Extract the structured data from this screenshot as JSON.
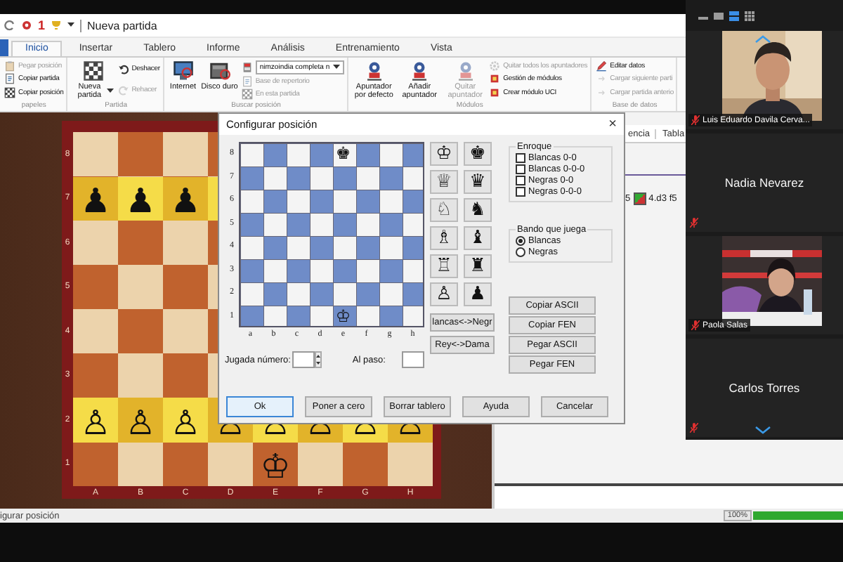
{
  "window": {
    "title": "Nueva partida",
    "quick_badge": "1"
  },
  "ribbon_tabs": [
    {
      "label": "Inicio",
      "selected": true
    },
    {
      "label": "Insertar",
      "selected": false
    },
    {
      "label": "Tablero",
      "selected": false
    },
    {
      "label": "Informe",
      "selected": false
    },
    {
      "label": "Análisis",
      "selected": false
    },
    {
      "label": "Entrenamiento",
      "selected": false
    },
    {
      "label": "Vista",
      "selected": false
    }
  ],
  "ribbon_groups": [
    {
      "label": "papeles",
      "items": [
        {
          "kind": "small",
          "label": "Pegar posición",
          "disabled": true
        },
        {
          "kind": "small",
          "label": "Copiar partida",
          "disabled": false
        },
        {
          "kind": "small",
          "label": "Copiar posición",
          "disabled": false
        }
      ]
    },
    {
      "label": "Partida",
      "items": [
        {
          "kind": "large-menu",
          "label": "Nueva partida",
          "disabled": false
        },
        {
          "kind": "small",
          "label": "Deshacer",
          "disabled": false
        },
        {
          "kind": "small",
          "label": "Rehacer",
          "disabled": true
        }
      ]
    },
    {
      "label": "Buscar posición",
      "items": [
        {
          "kind": "large",
          "label": "Internet",
          "disabled": false
        },
        {
          "kind": "large",
          "label": "Disco duro",
          "disabled": false
        },
        {
          "kind": "dropdown",
          "label": "nimzoindia completa n",
          "disabled": false
        },
        {
          "kind": "small",
          "label": "Base de repertorio",
          "disabled": true
        },
        {
          "kind": "small",
          "label": "En esta partida",
          "disabled": true
        }
      ]
    },
    {
      "label": "Módulos",
      "items": [
        {
          "kind": "large",
          "label": "Apuntador por defecto",
          "disabled": false
        },
        {
          "kind": "large",
          "label": "Añadir apuntador",
          "disabled": false
        },
        {
          "kind": "large",
          "label": "Quitar apuntador",
          "disabled": true
        },
        {
          "kind": "small",
          "label": "Quitar todos los apuntadores",
          "disabled": true
        },
        {
          "kind": "small",
          "label": "Gestión de módulos",
          "disabled": false
        },
        {
          "kind": "small",
          "label": "Crear módulo UCI",
          "disabled": false
        }
      ]
    },
    {
      "label": "Base de datos",
      "items": [
        {
          "kind": "small",
          "label": "Editar datos",
          "disabled": false
        },
        {
          "kind": "small",
          "label": "Cargar siguiente parti",
          "disabled": true
        },
        {
          "kind": "small",
          "label": "Cargar partida anterio",
          "disabled": true
        }
      ]
    }
  ],
  "board": {
    "ranks": [
      {
        "label": "8",
        "highlighted": false
      },
      {
        "label": "7",
        "highlighted": true,
        "cells": [
          "♟",
          "♟",
          "♟",
          null,
          null,
          null,
          null,
          null
        ]
      },
      {
        "label": "6",
        "highlighted": false
      },
      {
        "label": "5",
        "highlighted": false
      },
      {
        "label": "4",
        "highlighted": false
      },
      {
        "label": "3",
        "highlighted": false
      },
      {
        "label": "2",
        "highlighted": true,
        "cells": [
          "♙",
          "♙",
          "♙",
          "♙",
          "♙",
          "♙",
          "♙",
          "♙"
        ]
      },
      {
        "label": "1",
        "highlighted": false,
        "cells": [
          null,
          null,
          null,
          null,
          "♔",
          null,
          null,
          null
        ]
      }
    ],
    "files": [
      "A",
      "B",
      "C",
      "D",
      "E",
      "F",
      "G",
      "H"
    ]
  },
  "notation": {
    "tabs": [
      {
        "label": "encia"
      },
      {
        "label": "Tabla"
      }
    ],
    "move_prefix": "5",
    "moves": "4.d3 f5"
  },
  "status_bar": {
    "text": "igurar posición",
    "zoom": "100%",
    "zoom_level": {
      "level": 1
    }
  },
  "dialog": {
    "title": "Configurar posición",
    "close": "×",
    "board": {
      "ranks": [
        {
          "label": "8",
          "cells": [
            null,
            null,
            null,
            null,
            "♚",
            null,
            null,
            null
          ]
        },
        {
          "label": "7"
        },
        {
          "label": "6"
        },
        {
          "label": "5"
        },
        {
          "label": "4"
        },
        {
          "label": "3"
        },
        {
          "label": "2"
        },
        {
          "label": "1",
          "cells": [
            null,
            null,
            null,
            null,
            "♔",
            null,
            null,
            null
          ]
        }
      ],
      "files": [
        "a",
        "b",
        "c",
        "d",
        "e",
        "f",
        "g",
        "h"
      ]
    },
    "palette": [
      "♔",
      "♚",
      "♕",
      "♛",
      "♘",
      "♞",
      "♗",
      "♝",
      "♖",
      "♜",
      "♙",
      "♟"
    ],
    "swap_buttons": [
      "lancas<->Negr",
      "Rey<->Dama"
    ],
    "castling": {
      "label": "Enroque",
      "options": [
        {
          "label": "Blancas 0-0",
          "checked": false
        },
        {
          "label": "Blancas 0-0-0",
          "checked": false
        },
        {
          "label": "Negras 0-0",
          "checked": false
        },
        {
          "label": "Negras 0-0-0",
          "checked": false
        }
      ]
    },
    "side_to_move": {
      "label": "Bando que juega",
      "options": [
        {
          "label": "Blancas",
          "selected": true
        },
        {
          "label": "Negras",
          "selected": false
        }
      ]
    },
    "copy_buttons": [
      "Copiar ASCII",
      "Copiar FEN",
      "Pegar ASCII",
      "Pegar FEN"
    ],
    "move_number": {
      "label": "Jugada número:"
    },
    "en_passant": {
      "label": "Al paso:"
    },
    "buttons": [
      {
        "label": "Ok",
        "focused": true
      },
      {
        "label": "Poner a cero",
        "focused": false
      },
      {
        "label": "Borrar tablero",
        "focused": false
      },
      {
        "label": "Ayuda",
        "focused": false
      },
      {
        "label": "Cancelar",
        "focused": false
      }
    ]
  },
  "video_panel": {
    "view_buttons": [
      {
        "selected": false
      },
      {
        "selected": false
      },
      {
        "selected": true
      },
      {
        "selected": false
      }
    ],
    "participants": [
      {
        "kind": "video",
        "name": "Luis Eduardo Davila Cerva...",
        "muted": true
      },
      {
        "kind": "name",
        "name": "Nadia Nevarez",
        "muted": true
      },
      {
        "kind": "video",
        "name": "Paola Salas",
        "muted": true
      },
      {
        "kind": "name",
        "name": "Carlos Torres",
        "muted": true
      }
    ]
  }
}
